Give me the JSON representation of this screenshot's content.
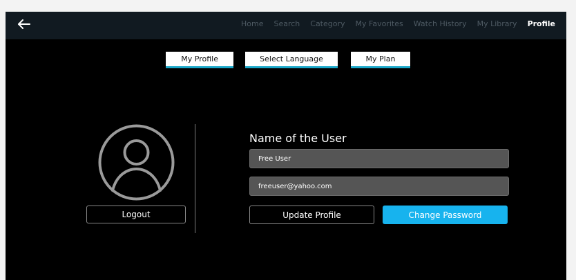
{
  "nav": {
    "back_icon": "arrow-left-icon",
    "items": [
      {
        "label": "Home"
      },
      {
        "label": "Search"
      },
      {
        "label": "Category"
      },
      {
        "label": "My Favorites"
      },
      {
        "label": "Watch History"
      },
      {
        "label": "My Library"
      },
      {
        "label": "Profile"
      }
    ],
    "active": "Profile"
  },
  "tabs": [
    {
      "label": "My Profile"
    },
    {
      "label": "Select Language"
    },
    {
      "label": "My Plan"
    }
  ],
  "profile": {
    "avatar_icon": "user-avatar-icon",
    "logout_label": "Logout",
    "title": "Name of the User",
    "name_value": "Free User",
    "email_value": "freeuser@yahoo.com",
    "update_label": "Update Profile",
    "change_password_label": "Change Password"
  },
  "colors": {
    "accent": "#17b3ee",
    "tab_underline": "#1aa7c9",
    "topbar": "#111a21",
    "background": "#000000"
  }
}
